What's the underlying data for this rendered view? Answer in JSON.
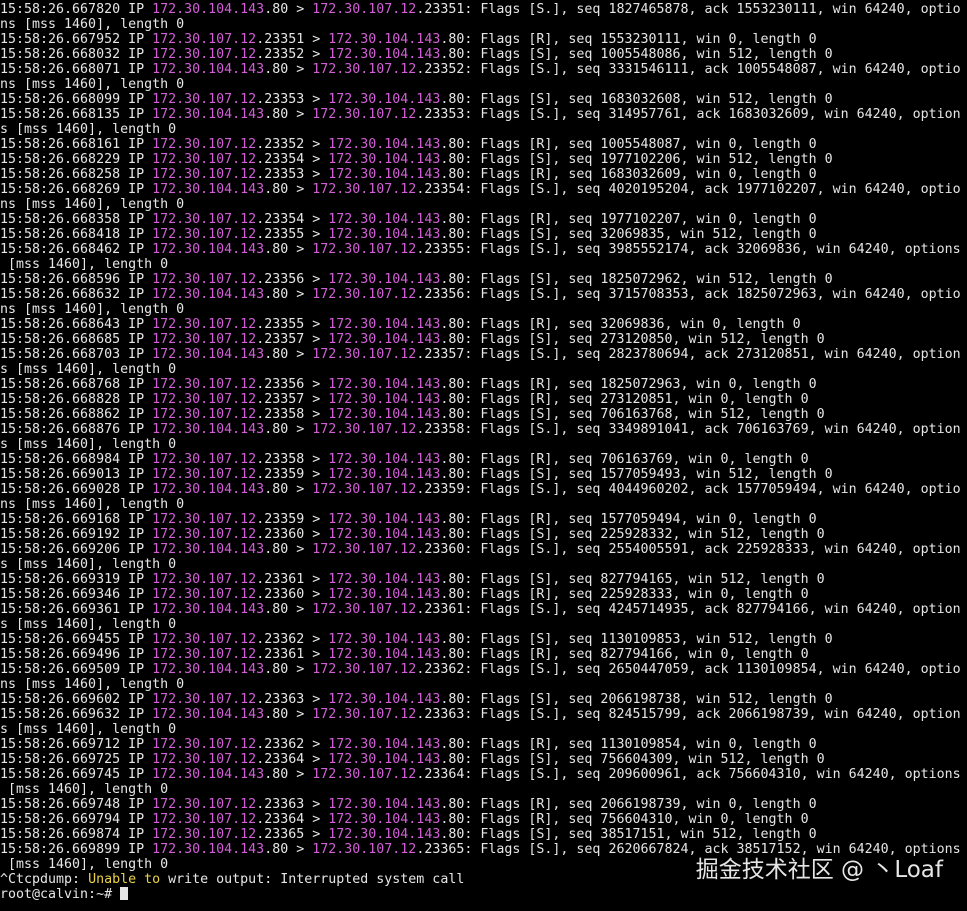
{
  "terminal": {
    "lines": [
      [
        [
          "15:58:26.667820 IP "
        ],
        [
          "172.30.104.143",
          "ip"
        ],
        [
          ".80 > "
        ],
        [
          "172.30.107.12",
          "ip"
        ],
        [
          ".23351: Flags [S.], seq 1827465878, ack 1553230111, win 64240, optio"
        ]
      ],
      [
        [
          "ns [mss 1460], length 0"
        ]
      ],
      [
        [
          "15:58:26.667952 IP "
        ],
        [
          "172.30.107.12",
          "ip"
        ],
        [
          ".23351 > "
        ],
        [
          "172.30.104.143",
          "ip"
        ],
        [
          ".80: Flags [R], seq 1553230111, win 0, length 0"
        ]
      ],
      [
        [
          "15:58:26.668032 IP "
        ],
        [
          "172.30.107.12",
          "ip"
        ],
        [
          ".23352 > "
        ],
        [
          "172.30.104.143",
          "ip"
        ],
        [
          ".80: Flags [S], seq 1005548086, win 512, length 0"
        ]
      ],
      [
        [
          "15:58:26.668071 IP "
        ],
        [
          "172.30.104.143",
          "ip"
        ],
        [
          ".80 > "
        ],
        [
          "172.30.107.12",
          "ip"
        ],
        [
          ".23352: Flags [S.], seq 3331546111, ack 1005548087, win 64240, optio"
        ]
      ],
      [
        [
          "ns [mss 1460], length 0"
        ]
      ],
      [
        [
          "15:58:26.668099 IP "
        ],
        [
          "172.30.107.12",
          "ip"
        ],
        [
          ".23353 > "
        ],
        [
          "172.30.104.143",
          "ip"
        ],
        [
          ".80: Flags [S], seq 1683032608, win 512, length 0"
        ]
      ],
      [
        [
          "15:58:26.668135 IP "
        ],
        [
          "172.30.104.143",
          "ip"
        ],
        [
          ".80 > "
        ],
        [
          "172.30.107.12",
          "ip"
        ],
        [
          ".23353: Flags [S.], seq 314957761, ack 1683032609, win 64240, option"
        ]
      ],
      [
        [
          "s [mss 1460], length 0"
        ]
      ],
      [
        [
          "15:58:26.668161 IP "
        ],
        [
          "172.30.107.12",
          "ip"
        ],
        [
          ".23352 > "
        ],
        [
          "172.30.104.143",
          "ip"
        ],
        [
          ".80: Flags [R], seq 1005548087, win 0, length 0"
        ]
      ],
      [
        [
          "15:58:26.668229 IP "
        ],
        [
          "172.30.107.12",
          "ip"
        ],
        [
          ".23354 > "
        ],
        [
          "172.30.104.143",
          "ip"
        ],
        [
          ".80: Flags [S], seq 1977102206, win 512, length 0"
        ]
      ],
      [
        [
          "15:58:26.668258 IP "
        ],
        [
          "172.30.107.12",
          "ip"
        ],
        [
          ".23353 > "
        ],
        [
          "172.30.104.143",
          "ip"
        ],
        [
          ".80: Flags [R], seq 1683032609, win 0, length 0"
        ]
      ],
      [
        [
          "15:58:26.668269 IP "
        ],
        [
          "172.30.104.143",
          "ip"
        ],
        [
          ".80 > "
        ],
        [
          "172.30.107.12",
          "ip"
        ],
        [
          ".23354: Flags [S.], seq 4020195204, ack 1977102207, win 64240, optio"
        ]
      ],
      [
        [
          "ns [mss 1460], length 0"
        ]
      ],
      [
        [
          "15:58:26.668358 IP "
        ],
        [
          "172.30.107.12",
          "ip"
        ],
        [
          ".23354 > "
        ],
        [
          "172.30.104.143",
          "ip"
        ],
        [
          ".80: Flags [R], seq 1977102207, win 0, length 0"
        ]
      ],
      [
        [
          "15:58:26.668418 IP "
        ],
        [
          "172.30.107.12",
          "ip"
        ],
        [
          ".23355 > "
        ],
        [
          "172.30.104.143",
          "ip"
        ],
        [
          ".80: Flags [S], seq 32069835, win 512, length 0"
        ]
      ],
      [
        [
          "15:58:26.668462 IP "
        ],
        [
          "172.30.104.143",
          "ip"
        ],
        [
          ".80 > "
        ],
        [
          "172.30.107.12",
          "ip"
        ],
        [
          ".23355: Flags [S.], seq 3985552174, ack 32069836, win 64240, options"
        ]
      ],
      [
        [
          " [mss 1460], length 0"
        ]
      ],
      [
        [
          "15:58:26.668596 IP "
        ],
        [
          "172.30.107.12",
          "ip"
        ],
        [
          ".23356 > "
        ],
        [
          "172.30.104.143",
          "ip"
        ],
        [
          ".80: Flags [S], seq 1825072962, win 512, length 0"
        ]
      ],
      [
        [
          "15:58:26.668632 IP "
        ],
        [
          "172.30.104.143",
          "ip"
        ],
        [
          ".80 > "
        ],
        [
          "172.30.107.12",
          "ip"
        ],
        [
          ".23356: Flags [S.], seq 3715708353, ack 1825072963, win 64240, optio"
        ]
      ],
      [
        [
          "ns [mss 1460], length 0"
        ]
      ],
      [
        [
          "15:58:26.668643 IP "
        ],
        [
          "172.30.107.12",
          "ip"
        ],
        [
          ".23355 > "
        ],
        [
          "172.30.104.143",
          "ip"
        ],
        [
          ".80: Flags [R], seq 32069836, win 0, length 0"
        ]
      ],
      [
        [
          "15:58:26.668685 IP "
        ],
        [
          "172.30.107.12",
          "ip"
        ],
        [
          ".23357 > "
        ],
        [
          "172.30.104.143",
          "ip"
        ],
        [
          ".80: Flags [S], seq 273120850, win 512, length 0"
        ]
      ],
      [
        [
          "15:58:26.668703 IP "
        ],
        [
          "172.30.104.143",
          "ip"
        ],
        [
          ".80 > "
        ],
        [
          "172.30.107.12",
          "ip"
        ],
        [
          ".23357: Flags [S.], seq 2823780694, ack 273120851, win 64240, option"
        ]
      ],
      [
        [
          "s [mss 1460], length 0"
        ]
      ],
      [
        [
          "15:58:26.668768 IP "
        ],
        [
          "172.30.107.12",
          "ip"
        ],
        [
          ".23356 > "
        ],
        [
          "172.30.104.143",
          "ip"
        ],
        [
          ".80: Flags [R], seq 1825072963, win 0, length 0"
        ]
      ],
      [
        [
          "15:58:26.668828 IP "
        ],
        [
          "172.30.107.12",
          "ip"
        ],
        [
          ".23357 > "
        ],
        [
          "172.30.104.143",
          "ip"
        ],
        [
          ".80: Flags [R], seq 273120851, win 0, length 0"
        ]
      ],
      [
        [
          "15:58:26.668862 IP "
        ],
        [
          "172.30.107.12",
          "ip"
        ],
        [
          ".23358 > "
        ],
        [
          "172.30.104.143",
          "ip"
        ],
        [
          ".80: Flags [S], seq 706163768, win 512, length 0"
        ]
      ],
      [
        [
          "15:58:26.668876 IP "
        ],
        [
          "172.30.104.143",
          "ip"
        ],
        [
          ".80 > "
        ],
        [
          "172.30.107.12",
          "ip"
        ],
        [
          ".23358: Flags [S.], seq 3349891041, ack 706163769, win 64240, option"
        ]
      ],
      [
        [
          "s [mss 1460], length 0"
        ]
      ],
      [
        [
          "15:58:26.668984 IP "
        ],
        [
          "172.30.107.12",
          "ip"
        ],
        [
          ".23358 > "
        ],
        [
          "172.30.104.143",
          "ip"
        ],
        [
          ".80: Flags [R], seq 706163769, win 0, length 0"
        ]
      ],
      [
        [
          "15:58:26.669013 IP "
        ],
        [
          "172.30.107.12",
          "ip"
        ],
        [
          ".23359 > "
        ],
        [
          "172.30.104.143",
          "ip"
        ],
        [
          ".80: Flags [S], seq 1577059493, win 512, length 0"
        ]
      ],
      [
        [
          "15:58:26.669028 IP "
        ],
        [
          "172.30.104.143",
          "ip"
        ],
        [
          ".80 > "
        ],
        [
          "172.30.107.12",
          "ip"
        ],
        [
          ".23359: Flags [S.], seq 4044960202, ack 1577059494, win 64240, optio"
        ]
      ],
      [
        [
          "ns [mss 1460], length 0"
        ]
      ],
      [
        [
          "15:58:26.669168 IP "
        ],
        [
          "172.30.107.12",
          "ip"
        ],
        [
          ".23359 > "
        ],
        [
          "172.30.104.143",
          "ip"
        ],
        [
          ".80: Flags [R], seq 1577059494, win 0, length 0"
        ]
      ],
      [
        [
          "15:58:26.669192 IP "
        ],
        [
          "172.30.107.12",
          "ip"
        ],
        [
          ".23360 > "
        ],
        [
          "172.30.104.143",
          "ip"
        ],
        [
          ".80: Flags [S], seq 225928332, win 512, length 0"
        ]
      ],
      [
        [
          "15:58:26.669206 IP "
        ],
        [
          "172.30.104.143",
          "ip"
        ],
        [
          ".80 > "
        ],
        [
          "172.30.107.12",
          "ip"
        ],
        [
          ".23360: Flags [S.], seq 2554005591, ack 225928333, win 64240, option"
        ]
      ],
      [
        [
          "s [mss 1460], length 0"
        ]
      ],
      [
        [
          "15:58:26.669319 IP "
        ],
        [
          "172.30.107.12",
          "ip"
        ],
        [
          ".23361 > "
        ],
        [
          "172.30.104.143",
          "ip"
        ],
        [
          ".80: Flags [S], seq 827794165, win 512, length 0"
        ]
      ],
      [
        [
          "15:58:26.669346 IP "
        ],
        [
          "172.30.107.12",
          "ip"
        ],
        [
          ".23360 > "
        ],
        [
          "172.30.104.143",
          "ip"
        ],
        [
          ".80: Flags [R], seq 225928333, win 0, length 0"
        ]
      ],
      [
        [
          "15:58:26.669361 IP "
        ],
        [
          "172.30.104.143",
          "ip"
        ],
        [
          ".80 > "
        ],
        [
          "172.30.107.12",
          "ip"
        ],
        [
          ".23361: Flags [S.], seq 4245714935, ack 827794166, win 64240, option"
        ]
      ],
      [
        [
          "s [mss 1460], length 0"
        ]
      ],
      [
        [
          "15:58:26.669455 IP "
        ],
        [
          "172.30.107.12",
          "ip"
        ],
        [
          ".23362 > "
        ],
        [
          "172.30.104.143",
          "ip"
        ],
        [
          ".80: Flags [S], seq 1130109853, win 512, length 0"
        ]
      ],
      [
        [
          "15:58:26.669496 IP "
        ],
        [
          "172.30.107.12",
          "ip"
        ],
        [
          ".23361 > "
        ],
        [
          "172.30.104.143",
          "ip"
        ],
        [
          ".80: Flags [R], seq 827794166, win 0, length 0"
        ]
      ],
      [
        [
          "15:58:26.669509 IP "
        ],
        [
          "172.30.104.143",
          "ip"
        ],
        [
          ".80 > "
        ],
        [
          "172.30.107.12",
          "ip"
        ],
        [
          ".23362: Flags [S.], seq 2650447059, ack 1130109854, win 64240, optio"
        ]
      ],
      [
        [
          "ns [mss 1460], length 0"
        ]
      ],
      [
        [
          "15:58:26.669602 IP "
        ],
        [
          "172.30.107.12",
          "ip"
        ],
        [
          ".23363 > "
        ],
        [
          "172.30.104.143",
          "ip"
        ],
        [
          ".80: Flags [S], seq 2066198738, win 512, length 0"
        ]
      ],
      [
        [
          "15:58:26.669632 IP "
        ],
        [
          "172.30.104.143",
          "ip"
        ],
        [
          ".80 > "
        ],
        [
          "172.30.107.12",
          "ip"
        ],
        [
          ".23363: Flags [S.], seq 824515799, ack 2066198739, win 64240, option"
        ]
      ],
      [
        [
          "s [mss 1460], length 0"
        ]
      ],
      [
        [
          "15:58:26.669712 IP "
        ],
        [
          "172.30.107.12",
          "ip"
        ],
        [
          ".23362 > "
        ],
        [
          "172.30.104.143",
          "ip"
        ],
        [
          ".80: Flags [R], seq 1130109854, win 0, length 0"
        ]
      ],
      [
        [
          "15:58:26.669725 IP "
        ],
        [
          "172.30.107.12",
          "ip"
        ],
        [
          ".23364 > "
        ],
        [
          "172.30.104.143",
          "ip"
        ],
        [
          ".80: Flags [S], seq 756604309, win 512, length 0"
        ]
      ],
      [
        [
          "15:58:26.669745 IP "
        ],
        [
          "172.30.104.143",
          "ip"
        ],
        [
          ".80 > "
        ],
        [
          "172.30.107.12",
          "ip"
        ],
        [
          ".23364: Flags [S.], seq 209600961, ack 756604310, win 64240, options"
        ]
      ],
      [
        [
          " [mss 1460], length 0"
        ]
      ],
      [
        [
          "15:58:26.669748 IP "
        ],
        [
          "172.30.107.12",
          "ip"
        ],
        [
          ".23363 > "
        ],
        [
          "172.30.104.143",
          "ip"
        ],
        [
          ".80: Flags [R], seq 2066198739, win 0, length 0"
        ]
      ],
      [
        [
          "15:58:26.669794 IP "
        ],
        [
          "172.30.107.12",
          "ip"
        ],
        [
          ".23364 > "
        ],
        [
          "172.30.104.143",
          "ip"
        ],
        [
          ".80: Flags [R], seq 756604310, win 0, length 0"
        ]
      ],
      [
        [
          "15:58:26.669874 IP "
        ],
        [
          "172.30.107.12",
          "ip"
        ],
        [
          ".23365 > "
        ],
        [
          "172.30.104.143",
          "ip"
        ],
        [
          ".80: Flags [S], seq 38517151, win 512, length 0"
        ]
      ],
      [
        [
          "15:58:26.669899 IP "
        ],
        [
          "172.30.104.143",
          "ip"
        ],
        [
          ".80 > "
        ],
        [
          "172.30.107.12",
          "ip"
        ],
        [
          ".23365: Flags [S.], seq 2620667824, ack 38517152, win 64240, options"
        ]
      ],
      [
        [
          " [mss 1460], length 0"
        ]
      ],
      [
        [
          "^Ctcpdump: "
        ],
        [
          "Unable to",
          "warn"
        ],
        [
          " write output: Interrupted system call"
        ]
      ]
    ],
    "prompt": "root@calvin:~# "
  },
  "watermark": "掘金技术社区 @ 丶Loaf",
  "colors": {
    "background": "#000000",
    "text": "#e6e6e6",
    "ip": "#d35fd7",
    "warning": "#e8d24a"
  }
}
